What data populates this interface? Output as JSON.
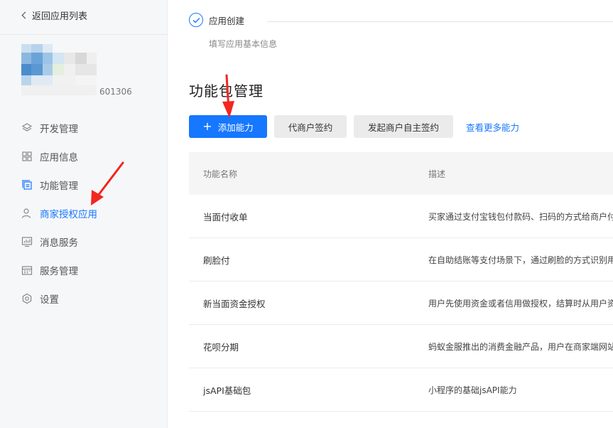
{
  "sidebar": {
    "back_label": "返回应用列表",
    "app_id_text": "601306",
    "items": [
      {
        "label": "开发管理",
        "icon": "layers-icon",
        "active": false
      },
      {
        "label": "应用信息",
        "icon": "grid-icon",
        "active": false
      },
      {
        "label": "功能管理",
        "icon": "copy-icon",
        "active": false
      },
      {
        "label": "商家授权应用",
        "icon": "user-icon",
        "active": true
      },
      {
        "label": "消息服务",
        "icon": "chart-monitor-icon",
        "active": false
      },
      {
        "label": "服务管理",
        "icon": "calendar-icon",
        "active": false
      },
      {
        "label": "设置",
        "icon": "gear-icon",
        "active": false
      }
    ]
  },
  "steps": {
    "title": "应用创建",
    "desc": "填写应用基本信息"
  },
  "main": {
    "section_title": "功能包管理",
    "add_button": "添加能力",
    "agent_sign_button": "代商户签约",
    "self_sign_button": "发起商户自主签约",
    "more_link": "查看更多能力"
  },
  "table": {
    "headers": [
      "功能名称",
      "描述"
    ],
    "rows": [
      {
        "name": "当面付收单",
        "desc": "买家通过支付宝钱包付款码、扫码的方式给商户付"
      },
      {
        "name": "刷脸付",
        "desc": "在自助结账等支付场景下，通过刷脸的方式识别用"
      },
      {
        "name": "新当面资金授权",
        "desc": "用户先使用资金或者信用做授权，结算时从用户资"
      },
      {
        "name": "花呗分期",
        "desc": "蚂蚁金服推出的消费金融产品，用户在商家端网站"
      },
      {
        "name": "jsAPI基础包",
        "desc": "小程序的基础jsAPI能力"
      }
    ]
  },
  "colors": {
    "accent": "#1677ff",
    "annotation_arrow": "#f2261f"
  }
}
